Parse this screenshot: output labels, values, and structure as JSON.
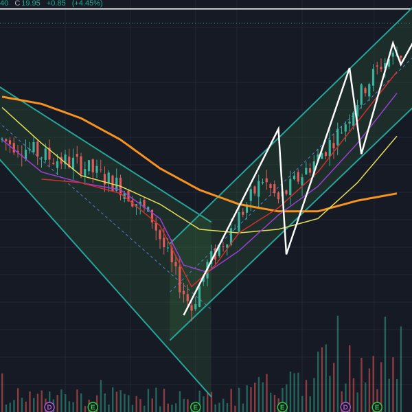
{
  "header": {
    "prev_value": "40",
    "close_label": "C",
    "close_value": "19.95",
    "change": "+0.85",
    "change_pct": "(+4.45%)"
  },
  "colors": {
    "background": "#161a25",
    "grid": "#232734",
    "up_candle": "#3db39e",
    "down_candle": "#e05c5c",
    "channel_stroke": "#26a69a",
    "channel_fill": "#4caf50",
    "ma_orange": "#f7931e",
    "ma_yellow": "#e8e05a",
    "ma_purple": "#9c3fd6",
    "ma_red": "#d32f2f",
    "zigzag": "#ffffff",
    "midline_dash": "#5b7bd5",
    "volume_up": "#2a7d6e",
    "volume_down": "#b14a4a",
    "event_earnings": "#2ecc40",
    "event_dividend": "#b259d0",
    "price_line_white": "#ffffff",
    "price_line_dotted": "#3aa39a"
  },
  "event_markers": [
    {
      "letter": "D",
      "color": "event_dividend",
      "bar": 12
    },
    {
      "letter": "E",
      "color": "event_earnings",
      "bar": 23
    },
    {
      "letter": "E",
      "color": "event_earnings",
      "bar": 49
    },
    {
      "letter": "E",
      "color": "event_earnings",
      "bar": 71
    },
    {
      "letter": "D",
      "color": "event_dividend",
      "bar": 87
    },
    {
      "letter": "E",
      "color": "event_earnings",
      "bar": 95
    }
  ],
  "chart_data": {
    "type": "candlestick",
    "bars": 102,
    "price_range": [
      11.5,
      23.0
    ],
    "series": [
      {
        "kind": "price",
        "trend_points": [
          [
            0,
            19.1
          ],
          [
            12,
            18.6
          ],
          [
            20,
            18.4
          ],
          [
            30,
            17.8
          ],
          [
            38,
            16.9
          ],
          [
            44,
            15.3
          ],
          [
            48,
            14.4
          ],
          [
            52,
            15.6
          ],
          [
            58,
            16.6
          ],
          [
            66,
            18.0
          ],
          [
            70,
            17.4
          ],
          [
            74,
            17.9
          ],
          [
            80,
            18.6
          ],
          [
            86,
            19.4
          ],
          [
            92,
            20.6
          ],
          [
            96,
            21.2
          ],
          [
            100,
            21.5
          ]
        ]
      },
      {
        "kind": "ma",
        "color": "ma_orange",
        "points": [
          [
            0,
            20.3
          ],
          [
            10,
            20.1
          ],
          [
            20,
            19.7
          ],
          [
            30,
            19.1
          ],
          [
            40,
            18.3
          ],
          [
            50,
            17.7
          ],
          [
            60,
            17.3
          ],
          [
            70,
            17.1
          ],
          [
            80,
            17.1
          ],
          [
            90,
            17.4
          ],
          [
            100,
            17.6
          ]
        ]
      },
      {
        "kind": "ma",
        "color": "ma_yellow",
        "points": [
          [
            0,
            20.0
          ],
          [
            10,
            19.0
          ],
          [
            20,
            18.1
          ],
          [
            30,
            17.8
          ],
          [
            40,
            17.3
          ],
          [
            50,
            16.6
          ],
          [
            60,
            16.5
          ],
          [
            70,
            16.6
          ],
          [
            80,
            16.9
          ],
          [
            90,
            17.9
          ],
          [
            100,
            19.2
          ]
        ]
      },
      {
        "kind": "ma",
        "color": "ma_purple",
        "points": [
          [
            0,
            19.1
          ],
          [
            10,
            18.2
          ],
          [
            20,
            17.9
          ],
          [
            30,
            17.7
          ],
          [
            40,
            16.9
          ],
          [
            46,
            15.6
          ],
          [
            52,
            15.4
          ],
          [
            60,
            16.0
          ],
          [
            70,
            17.0
          ],
          [
            80,
            17.8
          ],
          [
            90,
            19.0
          ],
          [
            100,
            20.4
          ]
        ]
      },
      {
        "kind": "ma",
        "color": "ma_red",
        "points": [
          [
            10,
            18.0
          ],
          [
            20,
            17.9
          ],
          [
            30,
            17.6
          ],
          [
            40,
            16.7
          ],
          [
            48,
            15.0
          ],
          [
            54,
            15.6
          ],
          [
            60,
            16.5
          ],
          [
            70,
            17.2
          ],
          [
            80,
            18.2
          ],
          [
            90,
            19.6
          ],
          [
            100,
            21.0
          ]
        ]
      }
    ],
    "descending_channel": {
      "upper": [
        [
          0,
          20.6
        ],
        [
          46,
          16.8
        ]
      ],
      "lower": [
        [
          0,
          18.6
        ],
        [
          54,
          11.8
        ]
      ]
    },
    "ascending_channel": {
      "upper": [
        [
          46,
          16.2
        ],
        [
          105,
          22.9
        ]
      ],
      "lower": [
        [
          44,
          13.5
        ],
        [
          105,
          20.1
        ]
      ]
    },
    "zigzag": [
      [
        46,
        14.2
      ],
      [
        70,
        19.4
      ],
      [
        72,
        15.9
      ],
      [
        88,
        21.1
      ],
      [
        91,
        18.7
      ],
      [
        99,
        21.8
      ],
      [
        101,
        21.2
      ],
      [
        105,
        22.0
      ]
    ],
    "horizontal_lines": [
      {
        "price": 22.75,
        "style": "solid"
      },
      {
        "price": 22.35,
        "style": "dotted"
      }
    ],
    "grid": true,
    "legend": "none"
  }
}
